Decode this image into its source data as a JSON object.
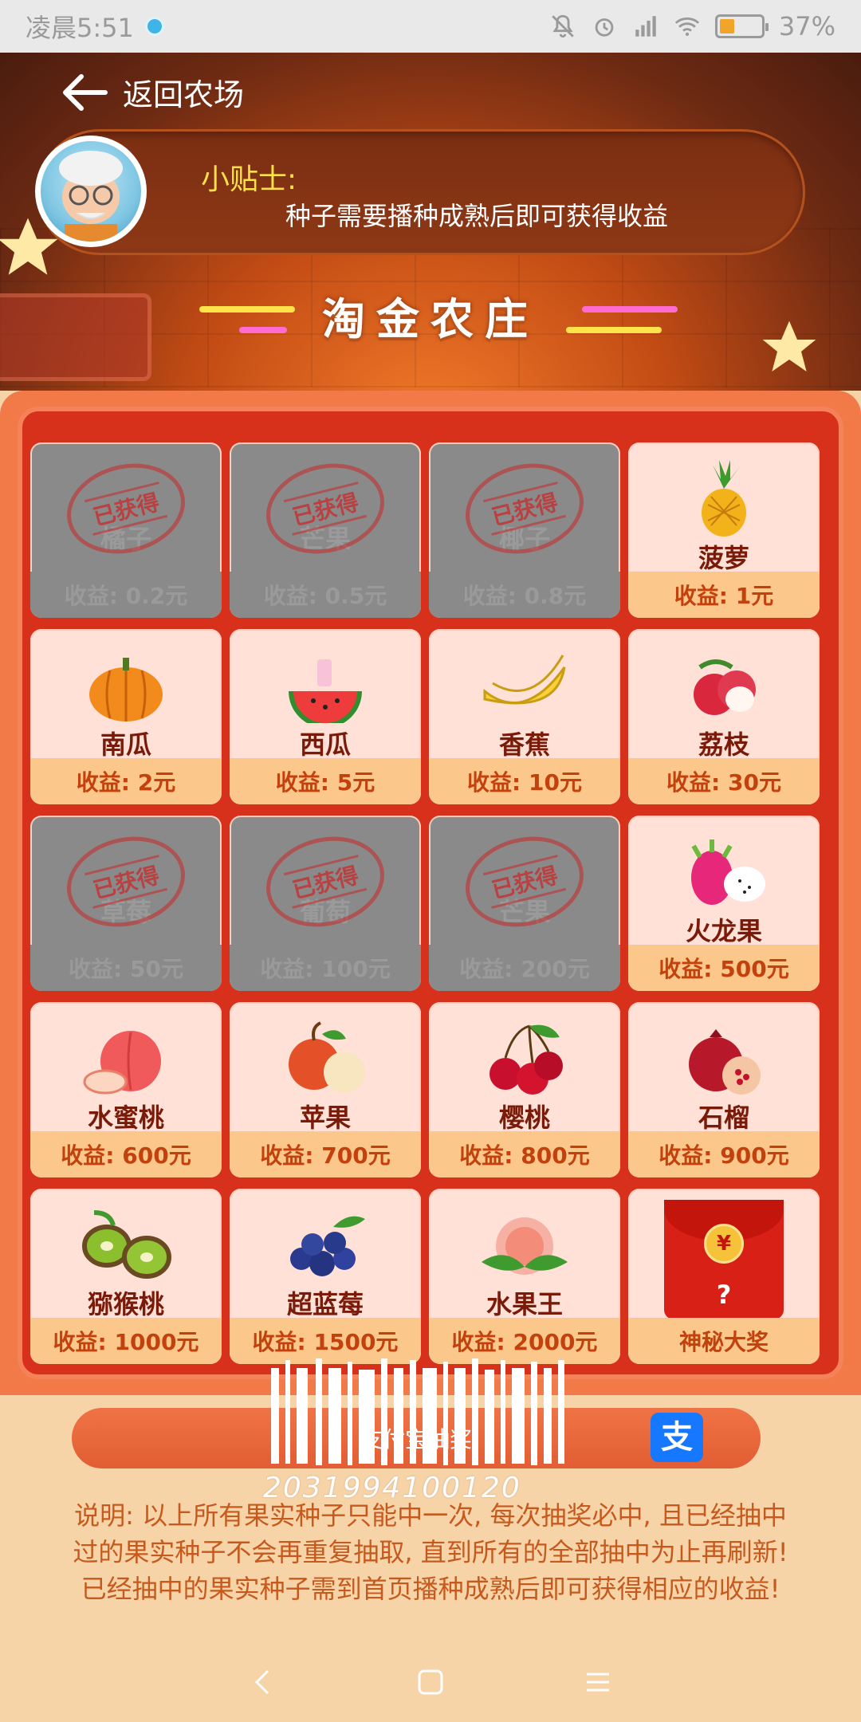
{
  "status_bar": {
    "time": "凌晨5:51",
    "battery": "37%",
    "battery_level": 0.37
  },
  "header": {
    "back_label": "返回农场",
    "tip_title": "小贴士:",
    "tip_text": "种子需要播种成熟后即可获得收益",
    "banner_title": "淘金农庄"
  },
  "grid": {
    "gotten_stamp": "已获得",
    "cells": [
      {
        "name": "橘子",
        "reward": "收益: 0.2元",
        "gotten": true
      },
      {
        "name": "芒果",
        "reward": "收益: 0.5元",
        "gotten": true
      },
      {
        "name": "椰子",
        "reward": "收益: 0.8元",
        "gotten": true
      },
      {
        "name": "菠萝",
        "reward": "收益: 1元",
        "gotten": false,
        "icon": "pineapple-icon"
      },
      {
        "name": "南瓜",
        "reward": "收益: 2元",
        "gotten": false,
        "icon": "pumpkin-icon"
      },
      {
        "name": "西瓜",
        "reward": "收益: 5元",
        "gotten": false,
        "icon": "watermelon-icon"
      },
      {
        "name": "香蕉",
        "reward": "收益: 10元",
        "gotten": false,
        "icon": "banana-icon"
      },
      {
        "name": "荔枝",
        "reward": "收益: 30元",
        "gotten": false,
        "icon": "lychee-icon"
      },
      {
        "name": "草莓",
        "reward": "收益: 50元",
        "gotten": true
      },
      {
        "name": "葡萄",
        "reward": "收益: 100元",
        "gotten": true
      },
      {
        "name": "芒果",
        "reward": "收益: 200元",
        "gotten": true
      },
      {
        "name": "火龙果",
        "reward": "收益: 500元",
        "gotten": false,
        "icon": "dragon-fruit-icon"
      },
      {
        "name": "水蜜桃",
        "reward": "收益: 600元",
        "gotten": false,
        "icon": "peach-icon"
      },
      {
        "name": "苹果",
        "reward": "收益: 700元",
        "gotten": false,
        "icon": "apple-icon"
      },
      {
        "name": "樱桃",
        "reward": "收益: 800元",
        "gotten": false,
        "icon": "cherry-icon"
      },
      {
        "name": "石榴",
        "reward": "收益: 900元",
        "gotten": false,
        "icon": "pomegranate-icon"
      },
      {
        "name": "猕猴桃",
        "reward": "收益: 1000元",
        "gotten": false,
        "icon": "kiwi-icon"
      },
      {
        "name": "超蓝莓",
        "reward": "收益: 1500元",
        "gotten": false,
        "icon": "blueberry-icon"
      },
      {
        "name": "水果王",
        "reward": "收益: 2000元",
        "gotten": false,
        "icon": "fruit-king-icon"
      },
      {
        "name": "神秘大奖",
        "reward": "神秘大奖",
        "gotten": false,
        "mystery": true,
        "icon": "red-envelope-icon"
      }
    ]
  },
  "draw_bar": {
    "label": "支付宝抽奖",
    "alipay_glyph": "支"
  },
  "watermark": {
    "number": "2031994100120"
  },
  "note": "说明: 以上所有果实种子只能中一次, 每次抽奖必中, 且已经抽中过的果实种子不会再重复抽取, 直到所有的全部抽中为止再刷新! 已经抽中的果实种子需到首页播种成熟后即可获得相应的收益!",
  "colors": {
    "accent": "#d7301b",
    "board_border": "#f58259",
    "reward_bg": "#fbc78b",
    "tip_title": "#ffe24a"
  }
}
